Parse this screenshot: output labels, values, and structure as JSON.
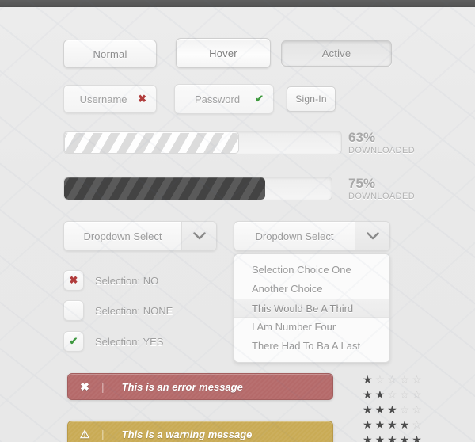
{
  "topbar": {
    "present": true,
    "color": "#585858"
  },
  "buttons": {
    "normal": "Normal",
    "hover": "Hover",
    "active": "Active",
    "signin": "Sign-In"
  },
  "fields": {
    "username": {
      "placeholder": "Username",
      "mark": "✖",
      "state": "invalid"
    },
    "password": {
      "placeholder": "Password",
      "mark": "✔",
      "state": "valid"
    }
  },
  "progress": [
    {
      "percent": "63%",
      "caption": "DOWNLOADED",
      "value": 63,
      "style": "light"
    },
    {
      "percent": "75%",
      "caption": "DOWNLOADED",
      "value": 75,
      "style": "dark"
    }
  ],
  "dropdowns": {
    "left": {
      "label": "Dropdown Select",
      "arrow": "⌄"
    },
    "right": {
      "label": "Dropdown Select",
      "arrow": "⌄"
    },
    "options": [
      {
        "label": "Selection Choice One",
        "selected": false
      },
      {
        "label": "Another Choice",
        "selected": false
      },
      {
        "label": "This Would Be A Third",
        "selected": true
      },
      {
        "label": "I Am Number Four",
        "selected": false
      },
      {
        "label": "There Had To Ba A Last",
        "selected": false
      }
    ]
  },
  "checkboxes": [
    {
      "label": "Selection: NO",
      "glyph": "✖",
      "state": "no"
    },
    {
      "label": "Selection: NONE",
      "glyph": "",
      "state": "none"
    },
    {
      "label": "Selection: YES",
      "glyph": "✔",
      "state": "yes"
    }
  ],
  "alerts": [
    {
      "type": "error",
      "icon": "✖",
      "separator": "|",
      "text": "This is an error message",
      "color": "#b56a6a"
    },
    {
      "type": "warning",
      "icon": "⚠",
      "separator": "|",
      "text": "This is a warning message",
      "color": "#c9ab55"
    }
  ],
  "star_ratings": {
    "max": 5,
    "filled_glyph": "★",
    "empty_glyph": "☆",
    "rows": [
      1,
      2,
      3,
      4,
      5
    ],
    "on_color": "#4b4b4b",
    "off_color": "#cfcfcf"
  }
}
